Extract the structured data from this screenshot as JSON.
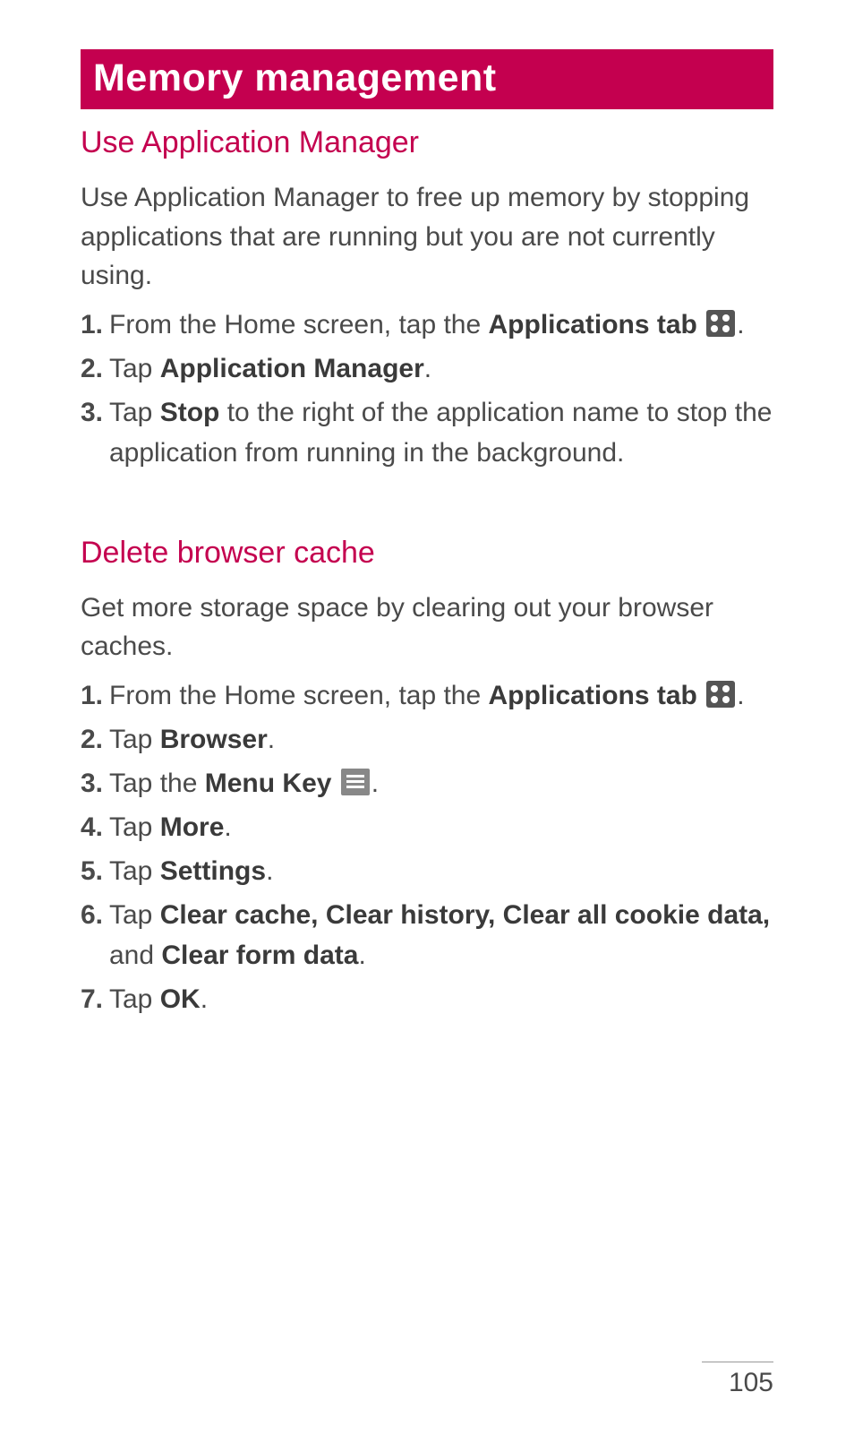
{
  "header": {
    "title": "Memory management"
  },
  "section1": {
    "title": "Use Application Manager",
    "intro": "Use Application Manager to free up memory by stopping applications that are running but you are not currently using.",
    "steps": {
      "s1_num": "1.",
      "s1_pre": "From the Home screen, tap the ",
      "s1_bold": "Applications tab",
      "s1_post": ".",
      "s2_num": "2.",
      "s2_pre": "Tap ",
      "s2_bold": "Application Manager",
      "s2_post": ".",
      "s3_num": "3.",
      "s3_pre": "Tap ",
      "s3_bold": "Stop",
      "s3_post": " to the right of the application name to stop the application from running in the background."
    }
  },
  "section2": {
    "title": "Delete browser cache",
    "intro": "Get more storage space by clearing out your browser caches.",
    "steps": {
      "s1_num": "1.",
      "s1_pre": "From the Home screen, tap the ",
      "s1_bold": "Applications tab",
      "s1_post": ".",
      "s2_num": "2.",
      "s2_pre": "Tap ",
      "s2_bold": "Browser",
      "s2_post": ".",
      "s3_num": "3.",
      "s3_pre": "Tap the ",
      "s3_bold": "Menu Key",
      "s3_post": ".",
      "s4_num": "4.",
      "s4_pre": "Tap ",
      "s4_bold": "More",
      "s4_post": ".",
      "s5_num": "5.",
      "s5_pre": "Tap ",
      "s5_bold": "Settings",
      "s5_post": ".",
      "s6_num": "6.",
      "s6_pre": "Tap ",
      "s6_bold": "Clear cache, Clear history, Clear all cookie data,",
      "s6_mid": " and ",
      "s6_bold2": "Clear form data",
      "s6_post": ".",
      "s7_num": "7.",
      "s7_pre": "Tap ",
      "s7_bold": "OK",
      "s7_post": "."
    }
  },
  "page_number": "105"
}
